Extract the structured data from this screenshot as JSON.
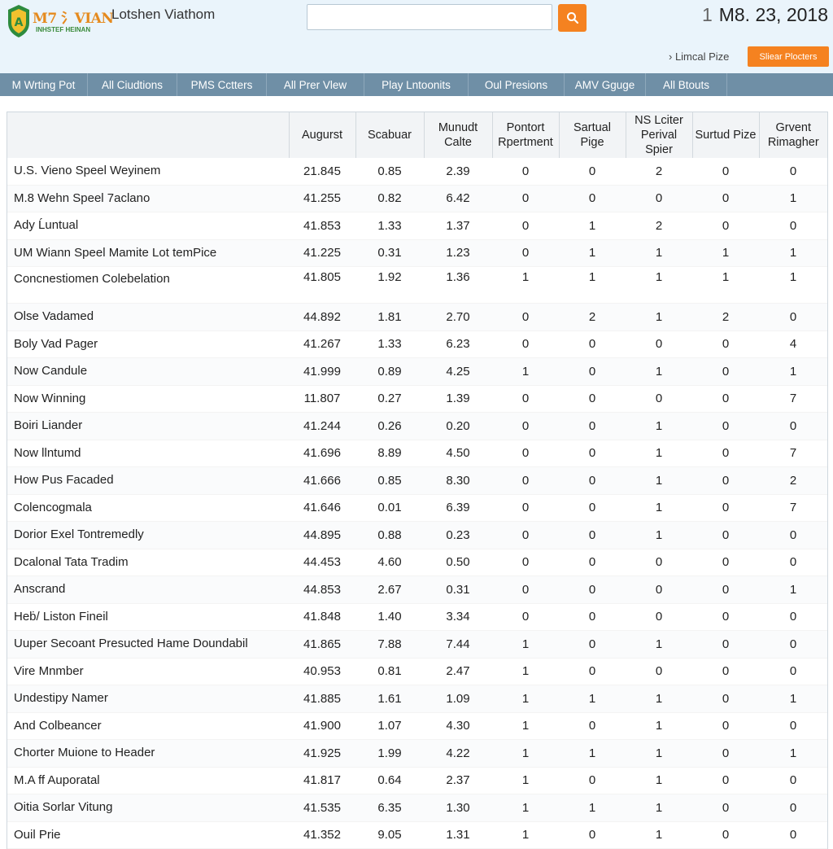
{
  "header": {
    "logo_text": "M7 氵VIAN",
    "logo_sub": "INHSTEF HEINAN",
    "site_title": "Lotshen Viathom",
    "search_value": "",
    "date_prefix": "1",
    "date": "M8. 23, 2018",
    "link_small": "› Limcal Pize",
    "orange_button": "Sliear Plocters",
    "colors": {
      "accent": "#f58220",
      "header_bg": "#eaf4fb",
      "nav_bg": "#6f8fa6"
    }
  },
  "nav": [
    {
      "label": "M Wrting Pot"
    },
    {
      "label": "All Ciudtions"
    },
    {
      "label": "PMS Cctters"
    },
    {
      "label": "All Prer Vlew"
    },
    {
      "label": "Play Lntoonits"
    },
    {
      "label": "Oul Presions"
    },
    {
      "label": "AMV Gguge"
    },
    {
      "label": "All Btouts"
    }
  ],
  "table": {
    "columns": [
      "",
      "Augurst",
      "Scabuar",
      "Munudt Calte",
      "Pontort Rpertment",
      "Sartual Pige",
      "NS Lciter Perival Spier",
      "Surtud Pize",
      "Grvent Rimagher"
    ],
    "rows": [
      [
        "U.S. Vieno Speel Weyinem",
        "21.845",
        "0.85",
        "2.39",
        "0",
        "0",
        "2",
        "0",
        "0"
      ],
      [
        "M.8 Wehn Speel 7aclano",
        "41.255",
        "0.82",
        "6.42",
        "0",
        "0",
        "0",
        "0",
        "1"
      ],
      [
        "Ady Ĺuntual",
        "41.853",
        "1.33",
        "1.37",
        "0",
        "1",
        "2",
        "0",
        "0"
      ],
      [
        "UM Wiann Speel Mamite Lot temPice",
        "41.225",
        "0.31",
        "1.23",
        "0",
        "1",
        "1",
        "1",
        "1"
      ],
      [
        "Concnestiomen Colebelation",
        "41.805",
        "1.92",
        "1.36",
        "1",
        "1",
        "1",
        "1",
        "1"
      ],
      [
        "Olse Vadamed",
        "44.892",
        "1.81",
        "2.70",
        "0",
        "2",
        "1",
        "2",
        "0"
      ],
      [
        "Boly Vad Pager",
        "41.267",
        "1.33",
        "6.23",
        "0",
        "0",
        "0",
        "0",
        "4"
      ],
      [
        "Now Candule",
        "41.999",
        "0.89",
        "4.25",
        "1",
        "0",
        "1",
        "0",
        "1"
      ],
      [
        "Now Winning",
        "11.807",
        "0.27",
        "1.39",
        "0",
        "0",
        "0",
        "0",
        "7"
      ],
      [
        "Boiri Liander",
        "41.244",
        "0.26",
        "0.20",
        "0",
        "0",
        "1",
        "0",
        "0"
      ],
      [
        "Now llntumd",
        "41.696",
        "8.89",
        "4.50",
        "0",
        "0",
        "1",
        "0",
        "7"
      ],
      [
        "How Pus Facaded",
        "41.666",
        "0.85",
        "8.30",
        "0",
        "0",
        "1",
        "0",
        "2"
      ],
      [
        "Colencogmala",
        "41.646",
        "0.01",
        "6.39",
        "0",
        "0",
        "1",
        "0",
        "7"
      ],
      [
        "Dorior Exel Tontremedly",
        "44.895",
        "0.88",
        "0.23",
        "0",
        "0",
        "1",
        "0",
        "0"
      ],
      [
        "Dcalonal Tata Tradim",
        "44.453",
        "4.60",
        "0.50",
        "0",
        "0",
        "0",
        "0",
        "0"
      ],
      [
        "Anscrand",
        "44.853",
        "2.67",
        "0.31",
        "0",
        "0",
        "0",
        "0",
        "1"
      ],
      [
        "Heḃ/ Liston Fineil",
        "41.848",
        "1.40",
        "3.34",
        "0",
        "0",
        "0",
        "0",
        "0"
      ],
      [
        "Uuper Secoant Presucted Hame Doundabil",
        "41.865",
        "7.88",
        "7.44",
        "1",
        "0",
        "1",
        "0",
        "0"
      ],
      [
        "Vire Mnmber",
        "40.953",
        "0.81",
        "2.47",
        "1",
        "0",
        "0",
        "0",
        "0"
      ],
      [
        "Undestipy Namer",
        "41.885",
        "1.61",
        "1.09",
        "1",
        "1",
        "1",
        "0",
        "1"
      ],
      [
        "And Colbeancer",
        "41.900",
        "1.07",
        "4.30",
        "1",
        "0",
        "1",
        "0",
        "0"
      ],
      [
        "Chorter Muione to Header",
        "41.925",
        "1.99",
        "4.22",
        "1",
        "1",
        "1",
        "0",
        "1"
      ],
      [
        "M.A ff Auporatal",
        "41.817",
        "0.64",
        "2.37",
        "1",
        "0",
        "1",
        "0",
        "0"
      ],
      [
        "Oitia Sorlar Vitung",
        "41.535",
        "6.35",
        "1.30",
        "1",
        "1",
        "1",
        "0",
        "0"
      ],
      [
        "Ouil Prie",
        "41.352",
        "9.05",
        "1.31",
        "1",
        "0",
        "1",
        "0",
        "0"
      ]
    ]
  }
}
